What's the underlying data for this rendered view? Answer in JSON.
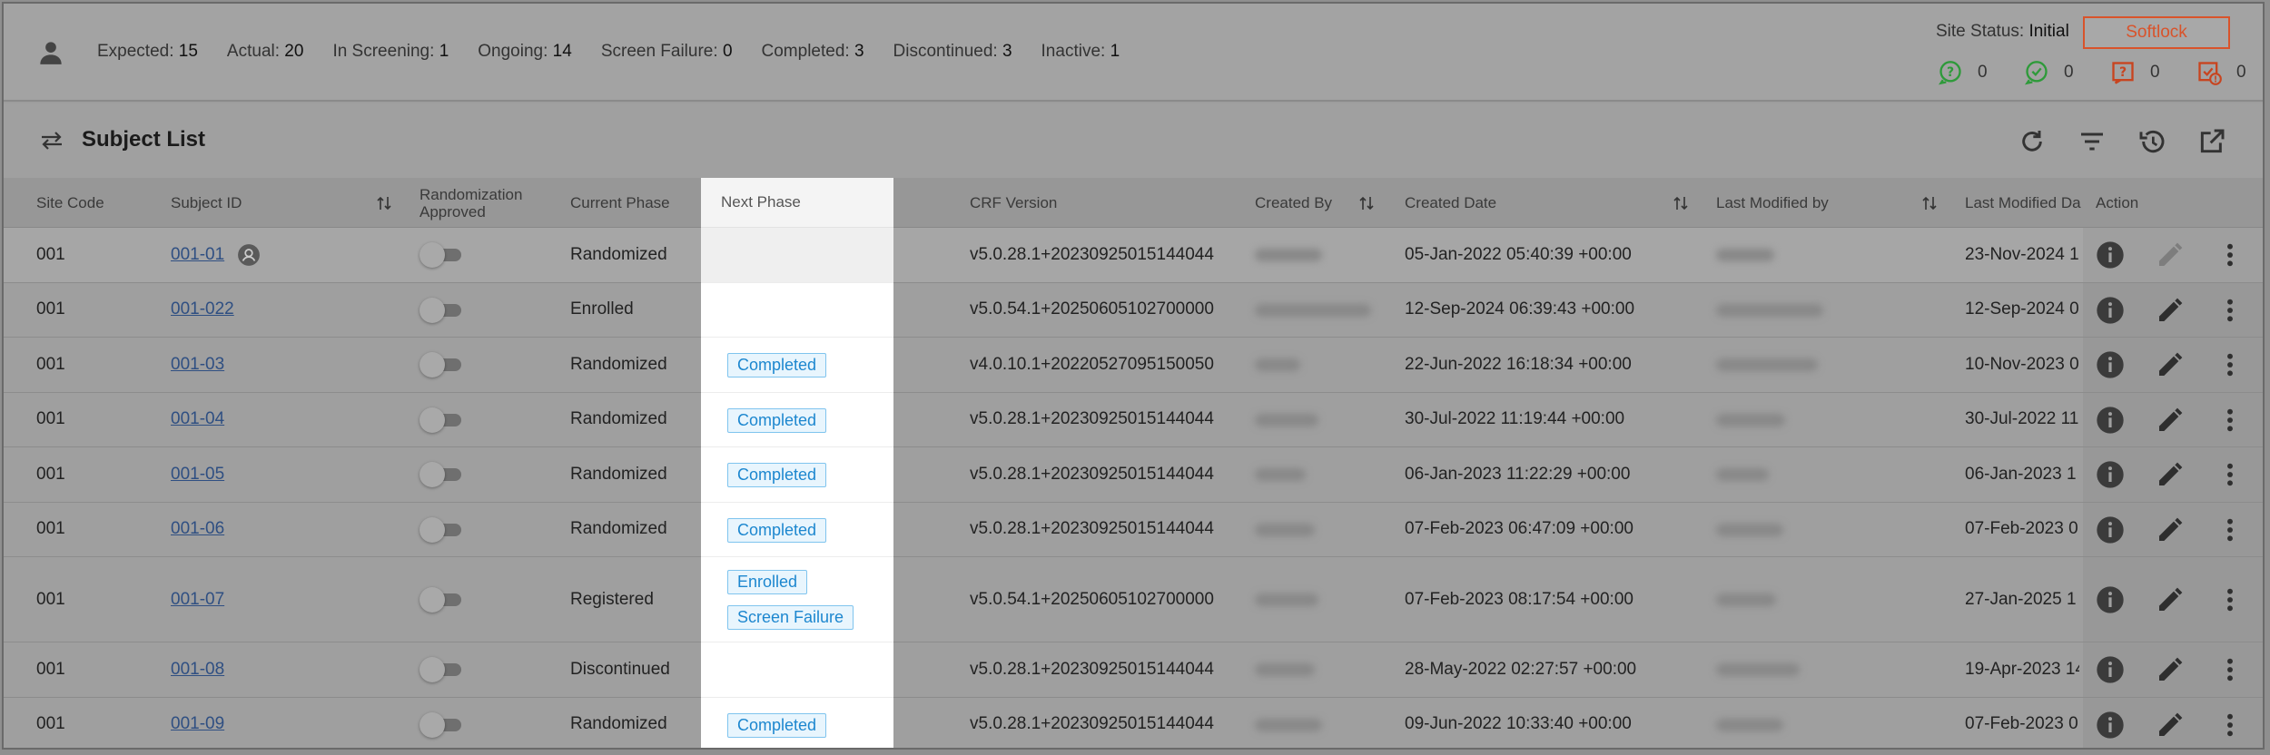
{
  "stats": [
    {
      "label": "Expected:",
      "value": "15"
    },
    {
      "label": "Actual:",
      "value": "20"
    },
    {
      "label": "In Screening:",
      "value": "1"
    },
    {
      "label": "Ongoing:",
      "value": "14"
    },
    {
      "label": "Screen Failure:",
      "value": "0"
    },
    {
      "label": "Completed:",
      "value": "3"
    },
    {
      "label": "Discontinued:",
      "value": "3"
    },
    {
      "label": "Inactive:",
      "value": "1"
    }
  ],
  "site_status": {
    "label": "Site Status:",
    "value": "Initial"
  },
  "softlock_label": "Softlock",
  "counters": [
    {
      "icon": "question-bubble-icon",
      "color": "#4caf50",
      "value": "0"
    },
    {
      "icon": "check-bubble-icon",
      "color": "#4caf50",
      "value": "0"
    },
    {
      "icon": "question-box-icon",
      "color": "#e0522e",
      "value": "0"
    },
    {
      "icon": "alert-box-icon",
      "color": "#e0522e",
      "value": "0"
    }
  ],
  "title": "Subject List",
  "columns": {
    "site_code": "Site Code",
    "subject_id": "Subject ID",
    "randomization_1": "Randomization",
    "randomization_2": "Approved",
    "current_phase": "Current Phase",
    "next_phase": "Next Phase",
    "crf_version": "CRF Version",
    "created_by": "Created By",
    "created_date": "Created Date",
    "last_modified_by": "Last Modified by",
    "last_modified_date": "Last Modified Da",
    "action": "Action"
  },
  "rows": [
    {
      "site": "001",
      "subject": "001-01",
      "phase": "Randomized",
      "next": [],
      "crf": "v5.0.28.1+20230925015144044",
      "created": "05-Jan-2022 05:40:39 +00:00",
      "modified": "23-Nov-2024 1"
    },
    {
      "site": "001",
      "subject": "001-022",
      "phase": "Enrolled",
      "next": [],
      "crf": "v5.0.54.1+20250605102700000",
      "created": "12-Sep-2024 06:39:43 +00:00",
      "modified": "12-Sep-2024 0"
    },
    {
      "site": "001",
      "subject": "001-03",
      "phase": "Randomized",
      "next": [
        "Completed"
      ],
      "crf": "v4.0.10.1+20220527095150050",
      "created": "22-Jun-2022 16:18:34 +00:00",
      "modified": "10-Nov-2023 0"
    },
    {
      "site": "001",
      "subject": "001-04",
      "phase": "Randomized",
      "next": [
        "Completed"
      ],
      "crf": "v5.0.28.1+20230925015144044",
      "created": "30-Jul-2022 11:19:44 +00:00",
      "modified": "30-Jul-2022 11"
    },
    {
      "site": "001",
      "subject": "001-05",
      "phase": "Randomized",
      "next": [
        "Completed"
      ],
      "crf": "v5.0.28.1+20230925015144044",
      "created": "06-Jan-2023 11:22:29 +00:00",
      "modified": "06-Jan-2023 1"
    },
    {
      "site": "001",
      "subject": "001-06",
      "phase": "Randomized",
      "next": [
        "Completed"
      ],
      "crf": "v5.0.28.1+20230925015144044",
      "created": "07-Feb-2023 06:47:09 +00:00",
      "modified": "07-Feb-2023 0"
    },
    {
      "site": "001",
      "subject": "001-07",
      "phase": "Registered",
      "next": [
        "Enrolled",
        "Screen Failure"
      ],
      "crf": "v5.0.54.1+20250605102700000",
      "created": "07-Feb-2023 08:17:54 +00:00",
      "modified": "27-Jan-2025 1"
    },
    {
      "site": "001",
      "subject": "001-08",
      "phase": "Discontinued",
      "next": [],
      "crf": "v5.0.28.1+20230925015144044",
      "created": "28-May-2022 02:27:57 +00:00",
      "modified": "19-Apr-2023 14"
    },
    {
      "site": "001",
      "subject": "001-09",
      "phase": "Randomized",
      "next": [
        "Completed"
      ],
      "crf": "v5.0.28.1+20230925015144044",
      "created": "09-Jun-2022 10:33:40 +00:00",
      "modified": "07-Feb-2023 0"
    }
  ]
}
